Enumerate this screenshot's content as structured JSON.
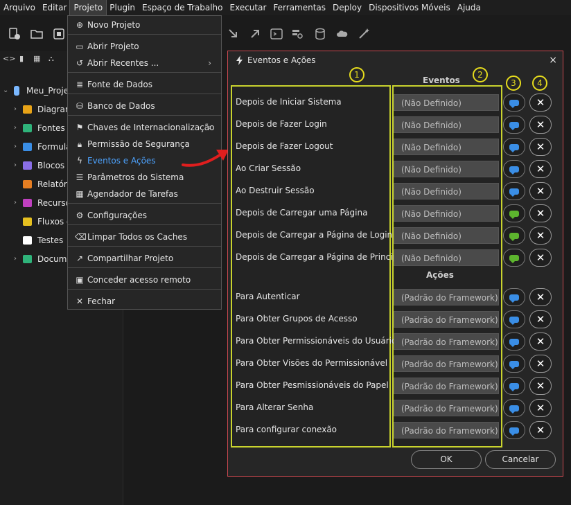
{
  "menubar": {
    "items": [
      "Arquivo",
      "Editar",
      "Projeto",
      "Plugin",
      "Espaço de Trabalho",
      "Executar",
      "Ferramentas",
      "Deploy",
      "Dispositivos Móveis",
      "Ajuda"
    ],
    "active": "Projeto"
  },
  "tree": {
    "root": "Meu_Projet",
    "items": [
      {
        "label": "Diagrama",
        "icon": "diagram-icon",
        "color": "#e8a317"
      },
      {
        "label": "Fontes d",
        "icon": "datasource-icon",
        "color": "#2fb37a"
      },
      {
        "label": "Formulá",
        "icon": "form-icon",
        "color": "#3a8ee6"
      },
      {
        "label": "Blocos d",
        "icon": "blocks-icon",
        "color": "#8a6ee6"
      },
      {
        "label": "Relatório",
        "icon": "report-icon",
        "color": "#e67e22"
      },
      {
        "label": "Recursos",
        "icon": "resources-icon",
        "color": "#c040c0"
      },
      {
        "label": "Fluxos d",
        "icon": "flows-icon",
        "color": "#e6c020"
      },
      {
        "label": "Testes",
        "icon": "tests-icon",
        "color": "#ffffff"
      },
      {
        "label": "Docume",
        "icon": "docs-icon",
        "color": "#2fb37a"
      }
    ]
  },
  "dropdown": {
    "items": [
      {
        "label": "Novo Projeto",
        "icon": "new-project-icon"
      },
      {
        "label": "Abrir Projeto",
        "icon": "folder-icon"
      },
      {
        "label": "Abrir Recentes ...",
        "icon": "history-icon",
        "submenu": "›"
      },
      {
        "label": "Fonte de Dados",
        "icon": "datasource-icon"
      },
      {
        "label": "Banco de Dados",
        "icon": "database-icon"
      },
      {
        "label": "Chaves de Internacionalização",
        "icon": "i18n-icon",
        "submenu": "›"
      },
      {
        "label": "Permissão de Segurança",
        "icon": "lock-icon"
      },
      {
        "label": "Eventos e Ações",
        "icon": "lightning-icon"
      },
      {
        "label": "Parâmetros do Sistema",
        "icon": "params-icon"
      },
      {
        "label": "Agendador de Tarefas",
        "icon": "calendar-icon"
      },
      {
        "label": "Configurações",
        "icon": "gear-icon"
      },
      {
        "label": "Limpar Todos os Caches",
        "icon": "broom-icon"
      },
      {
        "label": "Compartilhar Projeto",
        "icon": "share-icon"
      },
      {
        "label": "Conceder acesso remoto",
        "icon": "remote-icon"
      },
      {
        "label": "Fechar",
        "icon": "close-icon"
      }
    ]
  },
  "dialog": {
    "title": "Eventos e Ações",
    "close": "×",
    "events_header": "Eventos",
    "actions_header": "Ações",
    "markers": [
      "1",
      "2",
      "3",
      "4"
    ],
    "events": [
      {
        "label": "Depois de Iniciar Sistema",
        "value": "(Não Definido)"
      },
      {
        "label": "Depois de Fazer Login",
        "value": "(Não Definido)"
      },
      {
        "label": "Depois de Fazer Logout",
        "value": "(Não Definido)"
      },
      {
        "label": "Ao Criar Sessão",
        "value": "(Não Definido)"
      },
      {
        "label": "Ao Destruir Sessão",
        "value": "(Não Definido)"
      },
      {
        "label": "Depois de Carregar uma Página",
        "value": "(Não Definido)"
      },
      {
        "label": "Depois de Carregar a Página de Login",
        "value": "(Não Definido)"
      },
      {
        "label": "Depois de Carregar a Página de Principal",
        "value": "(Não Definido)"
      }
    ],
    "actions": [
      {
        "label": "Para Autenticar",
        "value": "(Padrão do Framework)"
      },
      {
        "label": "Para Obter Grupos de Acesso",
        "value": "(Padrão do Framework)"
      },
      {
        "label": "Para Obter Permissionáveis do Usuário",
        "value": "(Padrão do Framework)"
      },
      {
        "label": "Para Obter Visões do Permissionável",
        "value": "(Padrão do Framework)"
      },
      {
        "label": "Para Obter Pesmissionáveis do Papel",
        "value": "(Padrão do Framework)"
      },
      {
        "label": "Para Alterar Senha",
        "value": "(Padrão do Framework)"
      },
      {
        "label": "Para configurar conexão",
        "value": "(Padrão do Framework)"
      }
    ],
    "ok_label": "OK",
    "cancel_label": "Cancelar"
  },
  "colors": {
    "highlight_yellow": "#c9d32e",
    "dialog_border": "#c9484f",
    "selected_menu_text": "#4da3ff",
    "edit_blue": "#3a8ee6",
    "edit_green": "#5db52e",
    "arrow_red": "#e01e1e"
  }
}
